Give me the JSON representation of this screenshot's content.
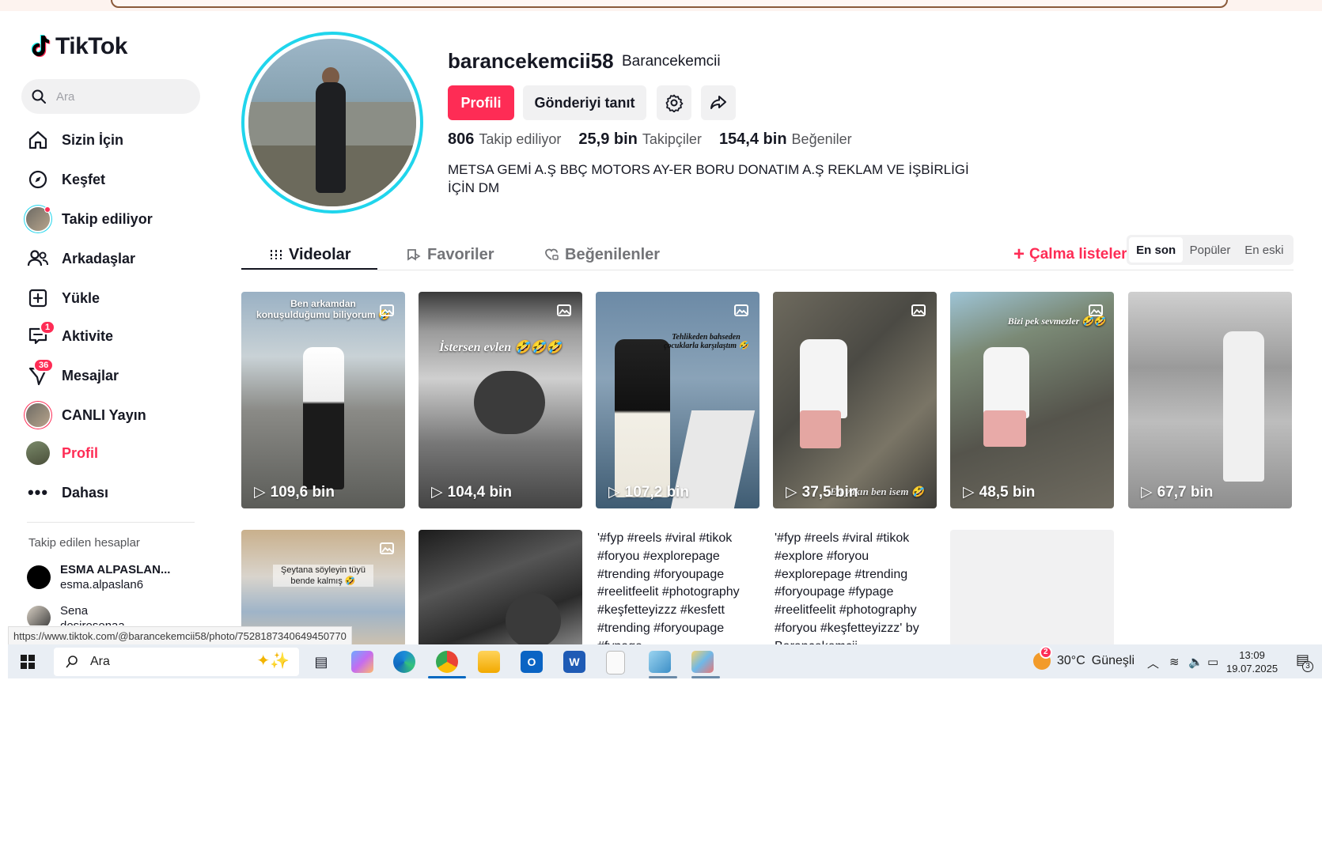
{
  "app": {
    "logo_text": "TikTok"
  },
  "sidebar": {
    "search_placeholder": "Ara",
    "items": [
      {
        "label": "Sizin İçin",
        "icon": "home-icon"
      },
      {
        "label": "Keşfet",
        "icon": "compass-icon"
      },
      {
        "label": "Takip ediliyor",
        "icon": "following-avatar"
      },
      {
        "label": "Arkadaşlar",
        "icon": "friends-icon"
      },
      {
        "label": "Yükle",
        "icon": "upload-icon"
      },
      {
        "label": "Aktivite",
        "icon": "activity-icon",
        "badge": "1"
      },
      {
        "label": "Mesajlar",
        "icon": "messages-icon",
        "badge": "36"
      },
      {
        "label": "CANLI Yayın",
        "icon": "live-avatar"
      },
      {
        "label": "Profil",
        "icon": "profile-avatar"
      },
      {
        "label": "Dahası",
        "icon": "more-icon"
      }
    ],
    "following_title": "Takip edilen hesaplar",
    "following": [
      {
        "name": "ESMA ALPASLAN...",
        "handle": "esma.alpaslan6"
      },
      {
        "name": "Sena",
        "handle": "desiresenaa"
      }
    ]
  },
  "profile": {
    "username": "barancekemcii58",
    "nickname": "Barancekemcii",
    "edit_button": "Profili",
    "promote_button": "Gönderiyi tanıt",
    "following_count": "806",
    "following_label": "Takip ediliyor",
    "followers_count": "25,9 bin",
    "followers_label": "Takipçiler",
    "likes_count": "154,4 bin",
    "likes_label": "Beğeniler",
    "bio": "METSA GEMİ A.Ş BBÇ MOTORS AY-ER BORU DONATIM A.Ş REKLAM VE İŞBİRLİGİ İÇİN DM"
  },
  "tabs": {
    "videos": "Videolar",
    "favorites": "Favoriler",
    "liked": "Beğenilenler",
    "playlists": "Çalma listeleri",
    "sort_options": [
      "En son",
      "Popüler",
      "En eski"
    ],
    "sort_selected": "En son"
  },
  "videos_row1": [
    {
      "views": "109,6 bin",
      "caption": "Ben arkamdan konuşulduğumu biliyorum 🤣"
    },
    {
      "views": "104,4 bin",
      "caption": "İstersen evlen 🤣🤣🤣"
    },
    {
      "views": "107,2 bin",
      "caption": "Tehlikeden bahseden çocuklarla karşılaştım 🤣"
    },
    {
      "views": "37,5 bin",
      "caption": "En yakın ben isem 🤣"
    },
    {
      "views": "48,5 bin",
      "caption": "Bizi pek sevmezler 🤣🤣"
    },
    {
      "views": "67,7 bin",
      "caption": ""
    }
  ],
  "videos_row2": [
    {
      "caption": "Şeytana söyleyin tüyü bende kalmış 🤣"
    },
    {
      "caption": ""
    },
    {
      "alt": "'#fyp #reels #viral #tikok #foryou #explorepage #trending #foryoupage #reelitfeelit #photography #keşfetteyizzz #kesfett #trending #foryoupage #fypage"
    },
    {
      "alt": "'#fyp #reels #viral #tikok #explore #foryou #explorepage #trending #foryoupage #fypage #reelitfeelit #photography #foryou #keşfetteyizzz' by Barancekemcii"
    }
  ],
  "status_url": "https://www.tiktok.com/@barancekemcii58/photo/7528187340649450770",
  "taskbar": {
    "search": "Ara",
    "weather_temp": "30°C",
    "weather_text": "Güneşli",
    "weather_badge": "2",
    "time": "13:09",
    "date": "19.07.2025",
    "notif_count": "3"
  },
  "colors": {
    "accent": "#fe2c55",
    "ring": "#20d5ec",
    "text": "#161823"
  }
}
